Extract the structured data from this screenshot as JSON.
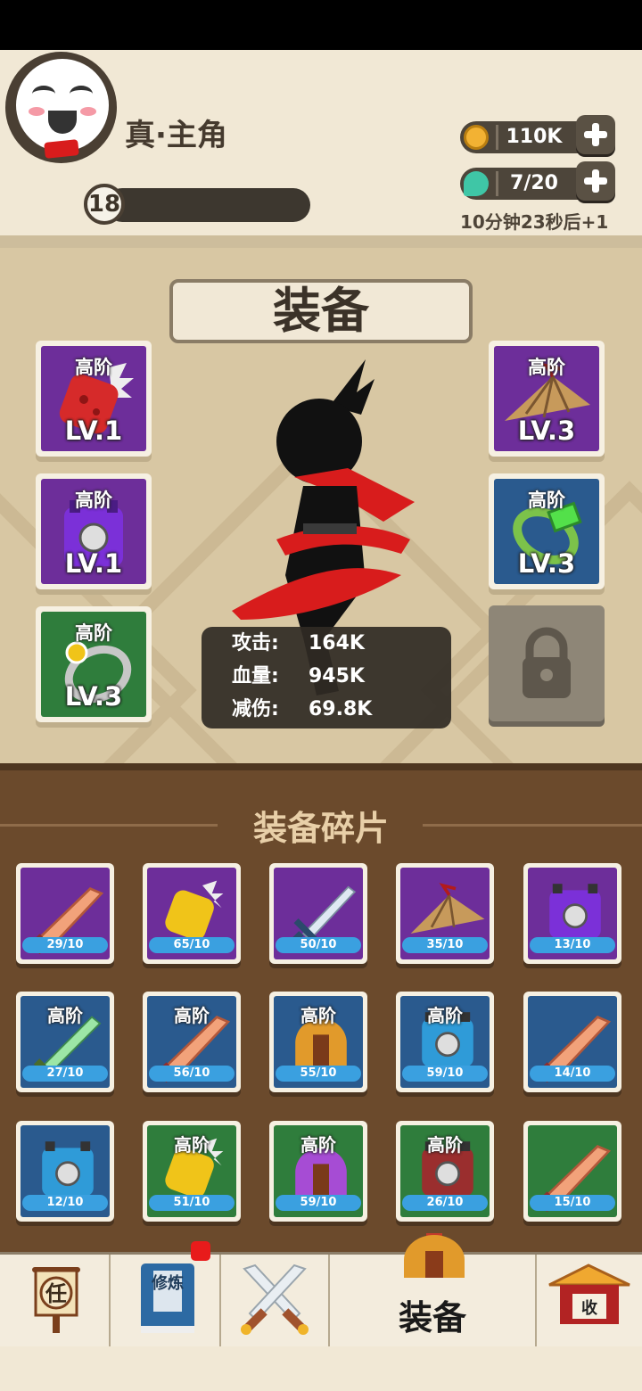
{
  "player": {
    "name": "真·主角",
    "level": "18",
    "exp_progress": 0.0
  },
  "resources": [
    {
      "name": "coin",
      "value": "110K",
      "color": "#f2b233"
    },
    {
      "name": "gem",
      "value": "7/20",
      "color": "#3fc6a6"
    }
  ],
  "timer_text": "10分钟23秒后+1",
  "equip": {
    "title": "装备",
    "slots": [
      {
        "tier": "高阶",
        "level": "LV.1",
        "bg": "#6d2e9a",
        "icon": "red-gauntlet-icon"
      },
      {
        "tier": "高阶",
        "level": "LV.1",
        "bg": "#6d2e9a",
        "icon": "purple-armor-icon"
      },
      {
        "tier": "高阶",
        "level": "LV.3",
        "bg": "#2f7d3c",
        "icon": "silver-ring-icon"
      },
      {
        "tier": "高阶",
        "level": "LV.3",
        "bg": "#6d2e9a",
        "icon": "straw-hat-icon"
      },
      {
        "tier": "高阶",
        "level": "LV.3",
        "bg": "#2a5a8e",
        "icon": "green-bracelet-icon"
      }
    ],
    "locked_slot_icon": "padlock-icon"
  },
  "stats": [
    {
      "label": "攻击:",
      "value": "164K"
    },
    {
      "label": "血量:",
      "value": "945K"
    },
    {
      "label": "减伤:",
      "value": "69.8K"
    }
  ],
  "fragments": {
    "title": "装备碎片",
    "items": [
      {
        "tier": "",
        "count": "29/10",
        "bg": "#6d2e9a",
        "icon": "blade-icon"
      },
      {
        "tier": "",
        "count": "65/10",
        "bg": "#6d2e9a",
        "icon": "gauntlet-icon"
      },
      {
        "tier": "",
        "count": "50/10",
        "bg": "#6d2e9a",
        "icon": "sword-icon"
      },
      {
        "tier": "",
        "count": "35/10",
        "bg": "#6d2e9a",
        "icon": "straw-hat-icon"
      },
      {
        "tier": "",
        "count": "13/10",
        "bg": "#6d2e9a",
        "icon": "armor-icon"
      },
      {
        "tier": "高阶",
        "count": "27/10",
        "bg": "#2a5a8e",
        "icon": "green-sword-icon"
      },
      {
        "tier": "高阶",
        "count": "56/10",
        "bg": "#2a5a8e",
        "icon": "blade-icon"
      },
      {
        "tier": "高阶",
        "count": "55/10",
        "bg": "#2a5a8e",
        "icon": "helmet-icon"
      },
      {
        "tier": "高阶",
        "count": "59/10",
        "bg": "#2a5a8e",
        "icon": "armor-icon"
      },
      {
        "tier": "",
        "count": "14/10",
        "bg": "#2a5a8e",
        "icon": "blade-icon"
      },
      {
        "tier": "",
        "count": "12/10",
        "bg": "#2a5a8e",
        "icon": "armor-icon"
      },
      {
        "tier": "高阶",
        "count": "51/10",
        "bg": "#2f7d3c",
        "icon": "gauntlet-icon"
      },
      {
        "tier": "高阶",
        "count": "59/10",
        "bg": "#2f7d3c",
        "icon": "helmet-icon"
      },
      {
        "tier": "高阶",
        "count": "26/10",
        "bg": "#2f7d3c",
        "icon": "armor-icon"
      },
      {
        "tier": "",
        "count": "15/10",
        "bg": "#2f7d3c",
        "icon": "blade-icon"
      }
    ]
  },
  "nav": {
    "tabs": [
      {
        "id": "task",
        "icon": "task-scroll-icon",
        "glyph": "任"
      },
      {
        "id": "train",
        "icon": "cultivation-book-icon",
        "glyph": "修炼",
        "has_badge": true
      },
      {
        "id": "battle",
        "icon": "crossed-swords-icon"
      },
      {
        "id": "equip",
        "icon": "helmet-icon",
        "label": "装备",
        "active": true
      },
      {
        "id": "collect",
        "icon": "treasure-house-icon",
        "glyph": "收"
      }
    ]
  }
}
